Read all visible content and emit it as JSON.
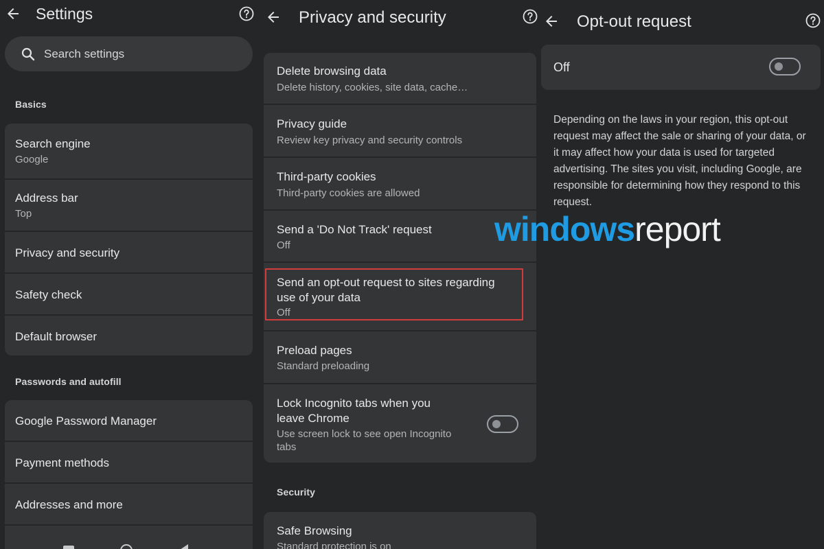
{
  "settings": {
    "title": "Settings",
    "search_placeholder": "Search settings",
    "sections": {
      "basics": "Basics",
      "passwords": "Passwords and autofill"
    },
    "items": {
      "search_engine": {
        "label": "Search engine",
        "value": "Google"
      },
      "address_bar": {
        "label": "Address bar",
        "value": "Top"
      },
      "privacy": {
        "label": "Privacy and security"
      },
      "safety_check": {
        "label": "Safety check"
      },
      "default_browser": {
        "label": "Default browser"
      },
      "password_manager": {
        "label": "Google Password Manager"
      },
      "payment_methods": {
        "label": "Payment methods"
      },
      "addresses": {
        "label": "Addresses and more"
      }
    }
  },
  "privacy": {
    "title": "Privacy and security",
    "items": {
      "delete_data": {
        "label": "Delete browsing data",
        "value": "Delete history, cookies, site data, cache…"
      },
      "privacy_guide": {
        "label": "Privacy guide",
        "value": "Review key privacy and security controls"
      },
      "third_party": {
        "label": "Third-party cookies",
        "value": "Third-party cookies are allowed"
      },
      "dnt": {
        "label": "Send a 'Do Not Track' request",
        "value": "Off"
      },
      "opt_out": {
        "label_line1": "Send an opt-out request to sites regarding",
        "label_line2": "use of your data",
        "value": "Off"
      },
      "preload": {
        "label": "Preload pages",
        "value": "Standard preloading"
      },
      "lock_incognito": {
        "label_line1": "Lock Incognito tabs when you",
        "label_line2": "leave Chrome",
        "value_line1": "Use screen lock to see open Incognito",
        "value_line2": "tabs",
        "toggle_on": false
      }
    },
    "section_security": "Security",
    "safe_browsing": {
      "label": "Safe Browsing",
      "value": "Standard protection is on"
    }
  },
  "opt_out": {
    "title": "Opt-out request",
    "toggle_label": "Off",
    "toggle_on": false,
    "description": "Depending on the laws in your region, this opt-out request may affect the sale or sharing of your data, or it may affect how your data is used for targeted advertising. The sites you visit, including Google, are responsible for determining how they respond to this request."
  },
  "watermark": {
    "part1": "windows",
    "part2": "report"
  },
  "icons": {
    "back": "arrow-back-icon",
    "help": "help-icon",
    "search": "search-icon"
  },
  "colors": {
    "background": "#252627",
    "card": "#343536",
    "highlight": "#d33c3c",
    "watermark_blue": "#1f9be3"
  }
}
